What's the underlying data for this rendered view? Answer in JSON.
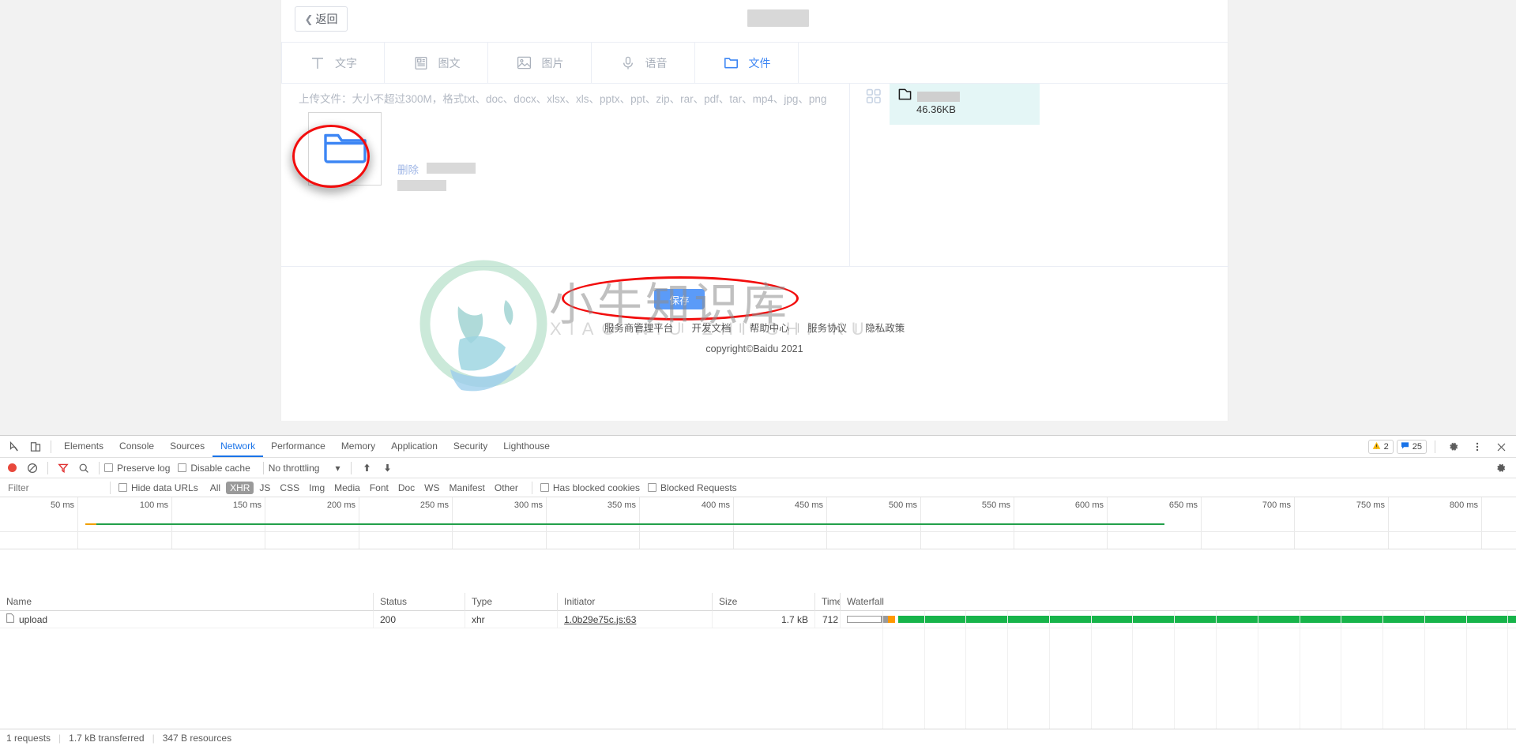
{
  "page": {
    "back_button": "返回",
    "tabs": [
      {
        "label": "文字",
        "icon": "text-icon",
        "active": false
      },
      {
        "label": "图文",
        "icon": "rich-text-icon",
        "active": false
      },
      {
        "label": "图片",
        "icon": "image-icon",
        "active": false
      },
      {
        "label": "语音",
        "icon": "microphone-icon",
        "active": false
      },
      {
        "label": "文件",
        "icon": "folder-icon",
        "active": true
      }
    ],
    "upload": {
      "hint": "上传文件：大小不超过300M，格式txt、doc、docx、xlsx、xls、pptx、ppt、zip、rar、pdf、tar、mp4、jpg、png",
      "dropzone_icon": "folder-upload-icon",
      "delete_label": "删除"
    },
    "file_list": {
      "grid_icon": "grid-view-icon",
      "item": {
        "icon": "folder-icon",
        "size": "46.36KB"
      }
    },
    "save_button": "保存",
    "footer": {
      "links": [
        "服务商管理平台",
        "开发文档",
        "帮助中心",
        "服务协议",
        "隐私政策"
      ],
      "divider": "|",
      "copyright": "copyright©Baidu 2021"
    },
    "watermark": {
      "title": "小牛知识库",
      "subtitle": "XIAO NIU ZHI SHI KU"
    }
  },
  "devtools": {
    "tabs": [
      "Elements",
      "Console",
      "Sources",
      "Network",
      "Performance",
      "Memory",
      "Application",
      "Security",
      "Lighthouse"
    ],
    "active_tab": "Network",
    "left_icons": [
      "inspect-element-icon",
      "device-toolbar-icon"
    ],
    "badges": {
      "warnings_icon": "warning-icon",
      "warnings": "2",
      "messages_icon": "message-icon",
      "messages": "25"
    },
    "right_icons": [
      "settings-gear-icon",
      "more-vertical-icon",
      "close-icon"
    ],
    "toolbar": {
      "record_icon": "record-button",
      "clear_icon": "clear-icon",
      "filter_icon": "filter-icon",
      "search_icon": "search-icon",
      "preserve_log": "Preserve log",
      "disable_cache": "Disable cache",
      "throttling": "No throttling",
      "import_icon": "import-har-icon",
      "export_icon": "export-har-icon",
      "settings_icon": "network-settings-icon"
    },
    "filterbar": {
      "placeholder": "Filter",
      "value": "",
      "hide_data_urls": "Hide data URLs",
      "types": [
        "All",
        "XHR",
        "JS",
        "CSS",
        "Img",
        "Media",
        "Font",
        "Doc",
        "WS",
        "Manifest",
        "Other"
      ],
      "active_type": "XHR",
      "has_blocked_cookies": "Has blocked cookies",
      "blocked_requests": "Blocked Requests"
    },
    "timeline": {
      "ticks": [
        "50 ms",
        "100 ms",
        "150 ms",
        "200 ms",
        "250 ms",
        "300 ms",
        "350 ms",
        "400 ms",
        "450 ms",
        "500 ms",
        "550 ms",
        "600 ms",
        "650 ms",
        "700 ms",
        "750 ms",
        "800 ms"
      ]
    },
    "table": {
      "columns": [
        "Name",
        "Status",
        "Type",
        "Initiator",
        "Size",
        "Time",
        "Waterfall"
      ],
      "rows": [
        {
          "name": "upload",
          "status": "200",
          "type": "xhr",
          "initiator": "1.0b29e75c.js:63",
          "size": "1.7 kB",
          "time": "712 ..."
        }
      ]
    },
    "status": {
      "requests": "1 requests",
      "transferred": "1.7 kB transferred",
      "resources": "347 B resources"
    }
  }
}
